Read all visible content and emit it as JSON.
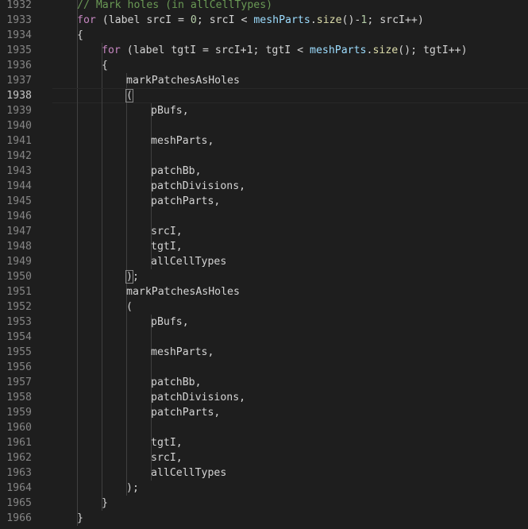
{
  "editor": {
    "current_line": "1938",
    "lines": [
      {
        "num": "1932",
        "indent": 1,
        "guides": 1,
        "tokens": [
          {
            "t": "// Mark holes (in allCellTypes)",
            "k": "cm"
          }
        ]
      },
      {
        "num": "1933",
        "indent": 1,
        "guides": 1,
        "tokens": [
          {
            "t": "for",
            "k": "kw"
          },
          {
            "t": " (label srcI = ",
            "k": "plain"
          },
          {
            "t": "0",
            "k": "num"
          },
          {
            "t": "; srcI < ",
            "k": "plain"
          },
          {
            "t": "meshParts",
            "k": "var"
          },
          {
            "t": ".",
            "k": "plain"
          },
          {
            "t": "size",
            "k": "fn"
          },
          {
            "t": "()-",
            "k": "plain"
          },
          {
            "t": "1",
            "k": "num"
          },
          {
            "t": "; srcI++)",
            "k": "plain"
          }
        ]
      },
      {
        "num": "1934",
        "indent": 1,
        "guides": 1,
        "tokens": [
          {
            "t": "{",
            "k": "plain"
          }
        ]
      },
      {
        "num": "1935",
        "indent": 2,
        "guides": 2,
        "tokens": [
          {
            "t": "for",
            "k": "kw"
          },
          {
            "t": " (label tgtI = srcI+1; tgtI < ",
            "k": "plain"
          },
          {
            "t": "meshParts",
            "k": "var"
          },
          {
            "t": ".",
            "k": "plain"
          },
          {
            "t": "size",
            "k": "fn"
          },
          {
            "t": "(); tgtI++)",
            "k": "plain"
          }
        ]
      },
      {
        "num": "1936",
        "indent": 2,
        "guides": 2,
        "tokens": [
          {
            "t": "{",
            "k": "plain"
          }
        ]
      },
      {
        "num": "1937",
        "indent": 3,
        "guides": 3,
        "tokens": [
          {
            "t": "markPatchesAsHoles",
            "k": "plain"
          }
        ]
      },
      {
        "num": "1938",
        "indent": 3,
        "guides": 3,
        "tokens": [
          {
            "t": "(",
            "k": "plain",
            "match": true
          }
        ]
      },
      {
        "num": "1939",
        "indent": 4,
        "guides": 4,
        "tokens": [
          {
            "t": "pBufs,",
            "k": "plain"
          }
        ]
      },
      {
        "num": "1940",
        "indent": 0,
        "guides": 4,
        "tokens": []
      },
      {
        "num": "1941",
        "indent": 4,
        "guides": 4,
        "tokens": [
          {
            "t": "meshParts,",
            "k": "plain"
          }
        ]
      },
      {
        "num": "1942",
        "indent": 0,
        "guides": 4,
        "tokens": []
      },
      {
        "num": "1943",
        "indent": 4,
        "guides": 4,
        "tokens": [
          {
            "t": "patchBb,",
            "k": "plain"
          }
        ]
      },
      {
        "num": "1944",
        "indent": 4,
        "guides": 4,
        "tokens": [
          {
            "t": "patchDivisions,",
            "k": "plain"
          }
        ]
      },
      {
        "num": "1945",
        "indent": 4,
        "guides": 4,
        "tokens": [
          {
            "t": "patchParts,",
            "k": "plain"
          }
        ]
      },
      {
        "num": "1946",
        "indent": 0,
        "guides": 4,
        "tokens": []
      },
      {
        "num": "1947",
        "indent": 4,
        "guides": 4,
        "tokens": [
          {
            "t": "srcI,",
            "k": "plain"
          }
        ]
      },
      {
        "num": "1948",
        "indent": 4,
        "guides": 4,
        "tokens": [
          {
            "t": "tgtI,",
            "k": "plain"
          }
        ]
      },
      {
        "num": "1949",
        "indent": 4,
        "guides": 4,
        "tokens": [
          {
            "t": "allCellTypes",
            "k": "plain"
          }
        ]
      },
      {
        "num": "1950",
        "indent": 3,
        "guides": 3,
        "tokens": [
          {
            "t": ")",
            "k": "plain",
            "match": true
          },
          {
            "t": ";",
            "k": "plain"
          }
        ]
      },
      {
        "num": "1951",
        "indent": 3,
        "guides": 3,
        "tokens": [
          {
            "t": "markPatchesAsHoles",
            "k": "plain"
          }
        ]
      },
      {
        "num": "1952",
        "indent": 3,
        "guides": 3,
        "tokens": [
          {
            "t": "(",
            "k": "plain"
          }
        ]
      },
      {
        "num": "1953",
        "indent": 4,
        "guides": 4,
        "tokens": [
          {
            "t": "pBufs,",
            "k": "plain"
          }
        ]
      },
      {
        "num": "1954",
        "indent": 0,
        "guides": 4,
        "tokens": []
      },
      {
        "num": "1955",
        "indent": 4,
        "guides": 4,
        "tokens": [
          {
            "t": "meshParts,",
            "k": "plain"
          }
        ]
      },
      {
        "num": "1956",
        "indent": 0,
        "guides": 4,
        "tokens": []
      },
      {
        "num": "1957",
        "indent": 4,
        "guides": 4,
        "tokens": [
          {
            "t": "patchBb,",
            "k": "plain"
          }
        ]
      },
      {
        "num": "1958",
        "indent": 4,
        "guides": 4,
        "tokens": [
          {
            "t": "patchDivisions,",
            "k": "plain"
          }
        ]
      },
      {
        "num": "1959",
        "indent": 4,
        "guides": 4,
        "tokens": [
          {
            "t": "patchParts,",
            "k": "plain"
          }
        ]
      },
      {
        "num": "1960",
        "indent": 0,
        "guides": 4,
        "tokens": []
      },
      {
        "num": "1961",
        "indent": 4,
        "guides": 4,
        "tokens": [
          {
            "t": "tgtI,",
            "k": "plain"
          }
        ]
      },
      {
        "num": "1962",
        "indent": 4,
        "guides": 4,
        "tokens": [
          {
            "t": "srcI,",
            "k": "plain"
          }
        ]
      },
      {
        "num": "1963",
        "indent": 4,
        "guides": 4,
        "tokens": [
          {
            "t": "allCellTypes",
            "k": "plain"
          }
        ]
      },
      {
        "num": "1964",
        "indent": 3,
        "guides": 3,
        "tokens": [
          {
            "t": ");",
            "k": "plain"
          }
        ]
      },
      {
        "num": "1965",
        "indent": 2,
        "guides": 2,
        "tokens": [
          {
            "t": "}",
            "k": "plain"
          }
        ]
      },
      {
        "num": "1966",
        "indent": 1,
        "guides": 1,
        "tokens": [
          {
            "t": "}",
            "k": "plain"
          }
        ]
      }
    ]
  },
  "colors": {
    "background": "#1e1e1e",
    "line_number": "#858585",
    "keyword": "#c586c0",
    "number": "#b5cea8",
    "variable": "#9cdcfe",
    "function": "#dcdcaa",
    "comment": "#6a9955",
    "text": "#d4d4d4"
  }
}
